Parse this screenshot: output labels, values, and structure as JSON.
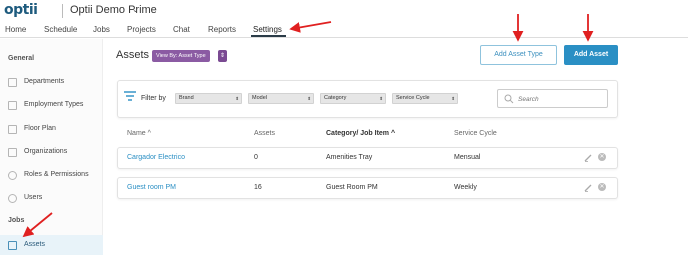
{
  "header": {
    "logo": "optii",
    "app_title": "Optii Demo Prime",
    "app_chevron": "⌄"
  },
  "nav": {
    "items": [
      {
        "label": "Home"
      },
      {
        "label": "Schedule"
      },
      {
        "label": "Jobs"
      },
      {
        "label": "Projects"
      },
      {
        "label": "Chat"
      },
      {
        "label": "Reports"
      },
      {
        "label": "Settings"
      }
    ],
    "active": "Settings"
  },
  "sidebar": {
    "general_heading": "General",
    "jobs_heading": "Jobs",
    "items": [
      {
        "label": "Departments",
        "icon": "grid-icon"
      },
      {
        "label": "Employment Types",
        "icon": "id-card-icon"
      },
      {
        "label": "Floor Plan",
        "icon": "floor-plan-icon"
      },
      {
        "label": "Organizations",
        "icon": "org-chart-icon"
      },
      {
        "label": "Roles & Permissions",
        "icon": "key-icon"
      },
      {
        "label": "Users",
        "icon": "user-icon"
      }
    ],
    "jobs_items": [
      {
        "label": "Assets",
        "icon": "cube-icon",
        "active": true
      }
    ]
  },
  "main": {
    "title": "Assets",
    "view_badge": "View By: Asset Type",
    "view_toggle": "⇕",
    "add_asset_type_label": "Add Asset Type",
    "add_asset_label": "Add Asset"
  },
  "filter": {
    "label": "Filter by",
    "dropdowns": [
      "Brand",
      "Model",
      "Category",
      "Service Cycle"
    ],
    "search_placeholder": "Search"
  },
  "table": {
    "columns": [
      "Name ^",
      "Assets",
      "Category/ Job Item ^",
      "Service Cycle"
    ],
    "rows": [
      {
        "name": "Cargador Electrico",
        "assets": "0",
        "category": "Amenities Tray",
        "cycle": "Mensual"
      },
      {
        "name": "Guest room PM",
        "assets": "16",
        "category": "Guest Room PM",
        "cycle": "Weekly"
      }
    ]
  },
  "colors": {
    "accent": "#2a8fc4",
    "badge": "#8b5ba3",
    "annotation": "#e02020"
  }
}
